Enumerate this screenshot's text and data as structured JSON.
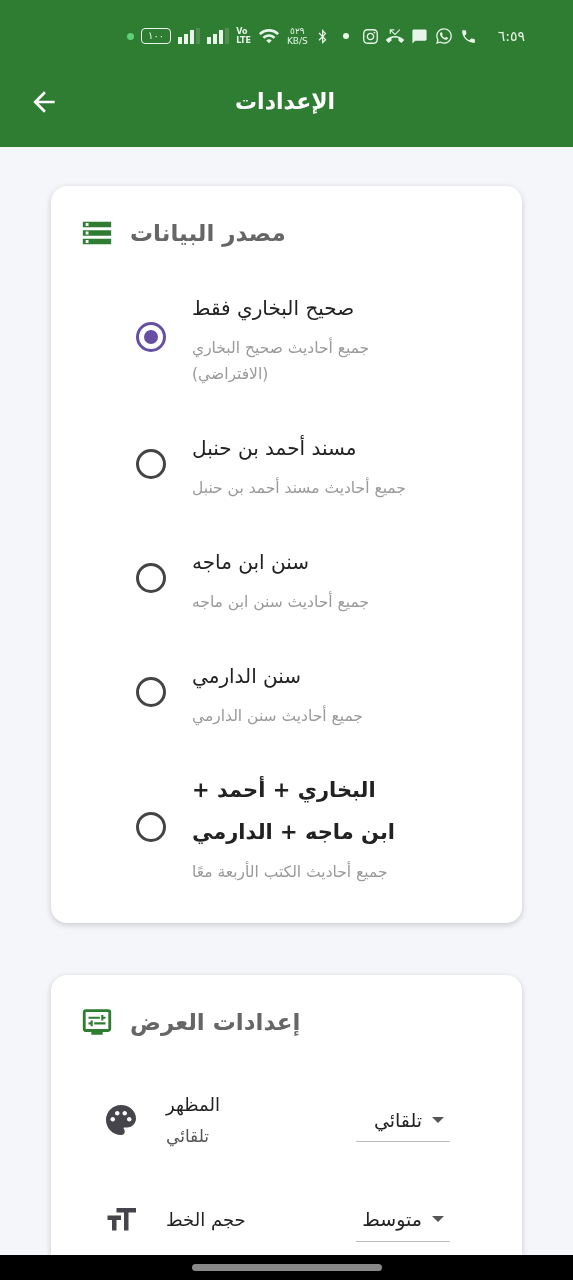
{
  "status_bar": {
    "battery": "١٠٠",
    "network": [
      "Vo",
      "LTE"
    ],
    "speed": "٥٢٩",
    "speed_unit": "KB/S",
    "time": "٦:٥٩"
  },
  "app_bar": {
    "title": "الإعدادات"
  },
  "data_source": {
    "title": "مصدر البيانات",
    "options": [
      {
        "title": "صحيح البخاري فقط",
        "subtitle": "جميع أحاديث صحيح البخاري (الافتراضي)",
        "selected": true
      },
      {
        "title": "مسند أحمد بن حنبل",
        "subtitle": "جميع أحاديث مسند أحمد بن حنبل",
        "selected": false
      },
      {
        "title": "سنن ابن ماجه",
        "subtitle": "جميع أحاديث سنن ابن ماجه",
        "selected": false
      },
      {
        "title": "سنن الدارمي",
        "subtitle": "جميع أحاديث سنن الدارمي",
        "selected": false
      },
      {
        "title": "البخاري + أحمد + ابن ماجه + الدارمي",
        "subtitle": "جميع أحاديث الكتب الأربعة معًا",
        "selected": false
      }
    ]
  },
  "display_settings": {
    "title": "إعدادات العرض",
    "rows": [
      {
        "kind": "theme",
        "title": "المظهر",
        "subtitle": "تلقائي",
        "value": "تلقائي"
      },
      {
        "kind": "font_size",
        "title": "حجم الخط",
        "value": "متوسط"
      }
    ]
  }
}
